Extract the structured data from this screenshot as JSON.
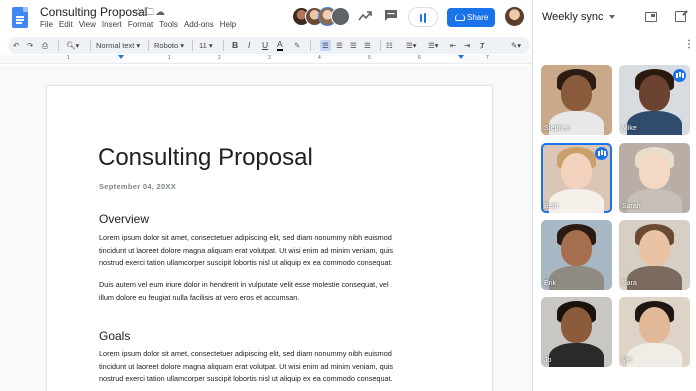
{
  "doc": {
    "title": "Consulting Proposal",
    "menu": [
      "File",
      "Edit",
      "View",
      "Insert",
      "Format",
      "Tools",
      "Add-ons",
      "Help"
    ],
    "share_label": "Share"
  },
  "toolbar": {
    "zoom_icon": "zoom-icon",
    "style": "Normal text",
    "font": "Roboto",
    "size": "11",
    "bold": "B",
    "italic": "I",
    "underline": "U",
    "text_color": "A"
  },
  "ruler": {
    "numbers": [
      "1",
      "1",
      "2",
      "3",
      "4",
      "5",
      "6",
      "7"
    ]
  },
  "page": {
    "heading": "Consulting Proposal",
    "date": "September 04, 20XX",
    "sections": [
      {
        "title": "Overview",
        "paragraphs": [
          [
            "Lorem ipsum dolor sit amet, consectetuer adipiscing elit, sed diam nonummy nibh euismod",
            "tincidunt ut laoreet dolore magna aliquam erat volutpat. Ut wisi enim ad minim veniam, quis",
            "nostrud exerci tation ullamcorper suscipit lobortis nisl ut aliquip ex ea commodo consequat."
          ],
          [
            "Duis autem vel eum iriure dolor in hendrerit in vulputate velit esse molestie consequat, vel",
            "illum dolore eu feugiat nulla facilisis at vero eros et accumsan."
          ]
        ]
      },
      {
        "title": "Goals",
        "paragraphs": [
          [
            "Lorem ipsum dolor sit amet, consectetuer adipiscing elit, sed diam nonummy nibh euismod",
            "tincidunt ut laoreet dolore magna aliquam erat volutpat. Ut wisi enim ad minim veniam, quis",
            "nostrud exerci tation ullamcorper suscipit lobortis nisl ut aliquip ex ea commodo consequat."
          ]
        ]
      }
    ]
  },
  "meet": {
    "title": "Weekly sync",
    "participants": [
      {
        "name": "Stephen",
        "speaking": false,
        "active": false,
        "bg": "#c9a98a",
        "skin": "#8a5a3c",
        "hair": "#2b1b12",
        "shirt": "#e8e8e8"
      },
      {
        "name": "Mike",
        "speaking": true,
        "active": false,
        "bg": "#d8dce0",
        "skin": "#6b4330",
        "hair": "#2a1a10",
        "shirt": "#2f4b6e"
      },
      {
        "name": "Beth",
        "speaking": true,
        "active": true,
        "bg": "#d9c6b7",
        "skin": "#f2d2bc",
        "hair": "#c9a06a",
        "shirt": "#f5f0ea"
      },
      {
        "name": "Sarah",
        "speaking": false,
        "active": false,
        "bg": "#b8aea6",
        "skin": "#f3d8c4",
        "hair": "#e8dccb",
        "shirt": "#c7c0b8"
      },
      {
        "name": "Erik",
        "speaking": false,
        "active": false,
        "bg": "#a7b8c4",
        "skin": "#a56f4f",
        "hair": "#2a1a12",
        "shirt": "#8f8a82"
      },
      {
        "name": "Sara",
        "speaking": false,
        "active": false,
        "bg": "#d8cfc4",
        "skin": "#e9c3a4",
        "hair": "#6b4a33",
        "shirt": "#7b6b5e"
      },
      {
        "name": "Jo",
        "speaking": false,
        "active": false,
        "bg": "#c9c7c3",
        "skin": "#8c5b3c",
        "hair": "#1b120c",
        "shirt": "#2a2a2a"
      },
      {
        "name": "Vel",
        "speaking": false,
        "active": false,
        "bg": "#ddd3c6",
        "skin": "#e1b898",
        "hair": "#1e1612",
        "shirt": "#f0ece6"
      }
    ]
  },
  "colors": {
    "accent": "#1a73e8",
    "docs_blue": "#4285f4"
  }
}
